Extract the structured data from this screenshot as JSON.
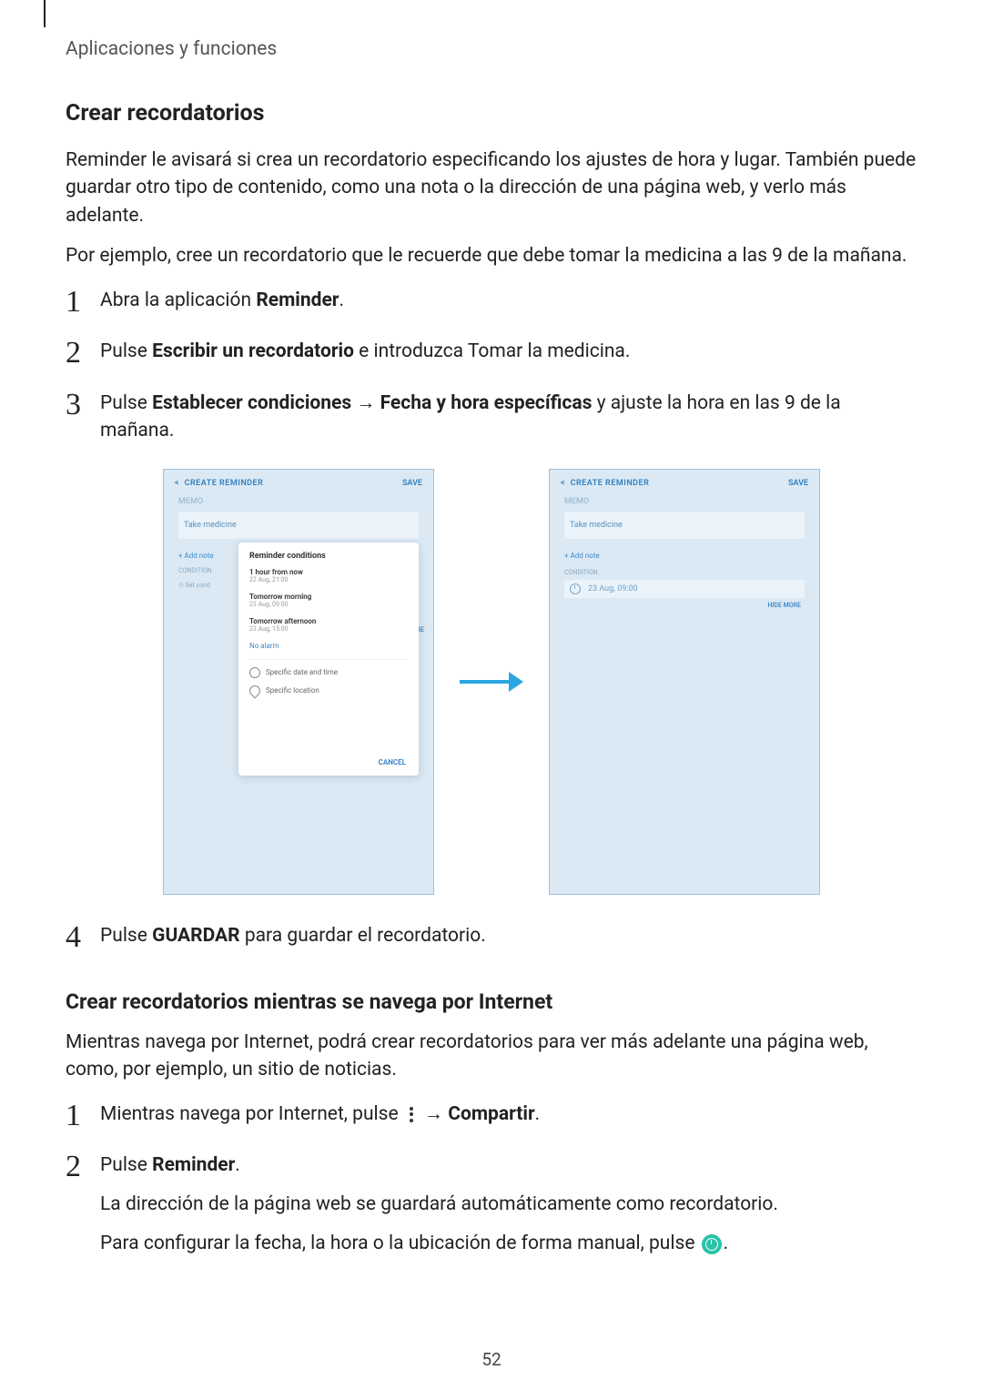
{
  "header": {
    "section": "Aplicaciones y funciones"
  },
  "sections": {
    "create": {
      "heading": "Crear recordatorios",
      "intro1": "Reminder le avisará si crea un recordatorio especificando los ajustes de hora y lugar. También puede guardar otro tipo de contenido, como una nota o la dirección de una página web, y verlo más adelante.",
      "intro2": "Por ejemplo, cree un recordatorio que le recuerde que debe tomar la medicina a las 9 de la mañana.",
      "steps": [
        {
          "num": "1",
          "pre": "Abra la aplicación",
          "bold": "Reminder",
          "post": "."
        },
        {
          "num": "2",
          "pre": "Pulse",
          "bold": "Escribir un recordatorio",
          "post": "e introduzca Tomar la medicina."
        },
        {
          "num": "3",
          "pre": "Pulse",
          "bold1": "Establecer condiciones",
          "arrow": "→",
          "bold2": "Fecha y hora específicas",
          "post": "y ajuste la hora en las 9 de la mañana."
        },
        {
          "num": "4",
          "pre": "Pulse",
          "bold": "GUARDAR",
          "post": "para guardar el recordatorio."
        }
      ]
    },
    "browse": {
      "heading": "Crear recordatorios mientras se navega por Internet",
      "intro": "Mientras navega por Internet, podrá crear recordatorios para ver más adelante una página web, como, por ejemplo, un sitio de noticias.",
      "steps": [
        {
          "num": "1",
          "pre": "Mientras navega por Internet, pulse",
          "arrow": "→",
          "bold": "Compartir",
          "post": "."
        },
        {
          "num": "2",
          "pre": "Pulse",
          "bold": "Reminder",
          "post": ".",
          "sub1": "La dirección de la página web se guardará automáticamente como recordatorio.",
          "sub2_pre": "Para configurar la fecha, la hora o la ubicación de forma manual, pulse ",
          "sub2_post": "."
        }
      ]
    }
  },
  "shots": {
    "a": {
      "header_left_arrow": "<",
      "header_left": "CREATE REMINDER",
      "header_right": "SAVE",
      "memo": "MEMO",
      "input": "Take medicine",
      "add_note": "+ Add note",
      "condition_label": "CONDITION",
      "set_cond": "⊙ Set cond",
      "hide_more": "HIDE MORE",
      "popup": {
        "title": "Reminder conditions",
        "items": [
          {
            "t": "1 hour from now",
            "s": "22 Aug, 21:00"
          },
          {
            "t": "Tomorrow morning",
            "s": "23 Aug, 09:00"
          },
          {
            "t": "Tomorrow afternoon",
            "s": "23 Aug, 15:00"
          }
        ],
        "no_alarm": "No alarm",
        "specific_date": "Specific date and time",
        "specific_location": "Specific location",
        "cancel": "CANCEL"
      }
    },
    "b": {
      "header_left_arrow": "<",
      "header_left": "CREATE REMINDER",
      "header_right": "SAVE",
      "memo": "MEMO",
      "input": "Take medicine",
      "add_note": "+ Add note",
      "condition_label": "CONDITION",
      "condition_value": "23 Aug, 09:00",
      "hide_more": "HIDE MORE"
    }
  },
  "footer": {
    "page": "52"
  }
}
